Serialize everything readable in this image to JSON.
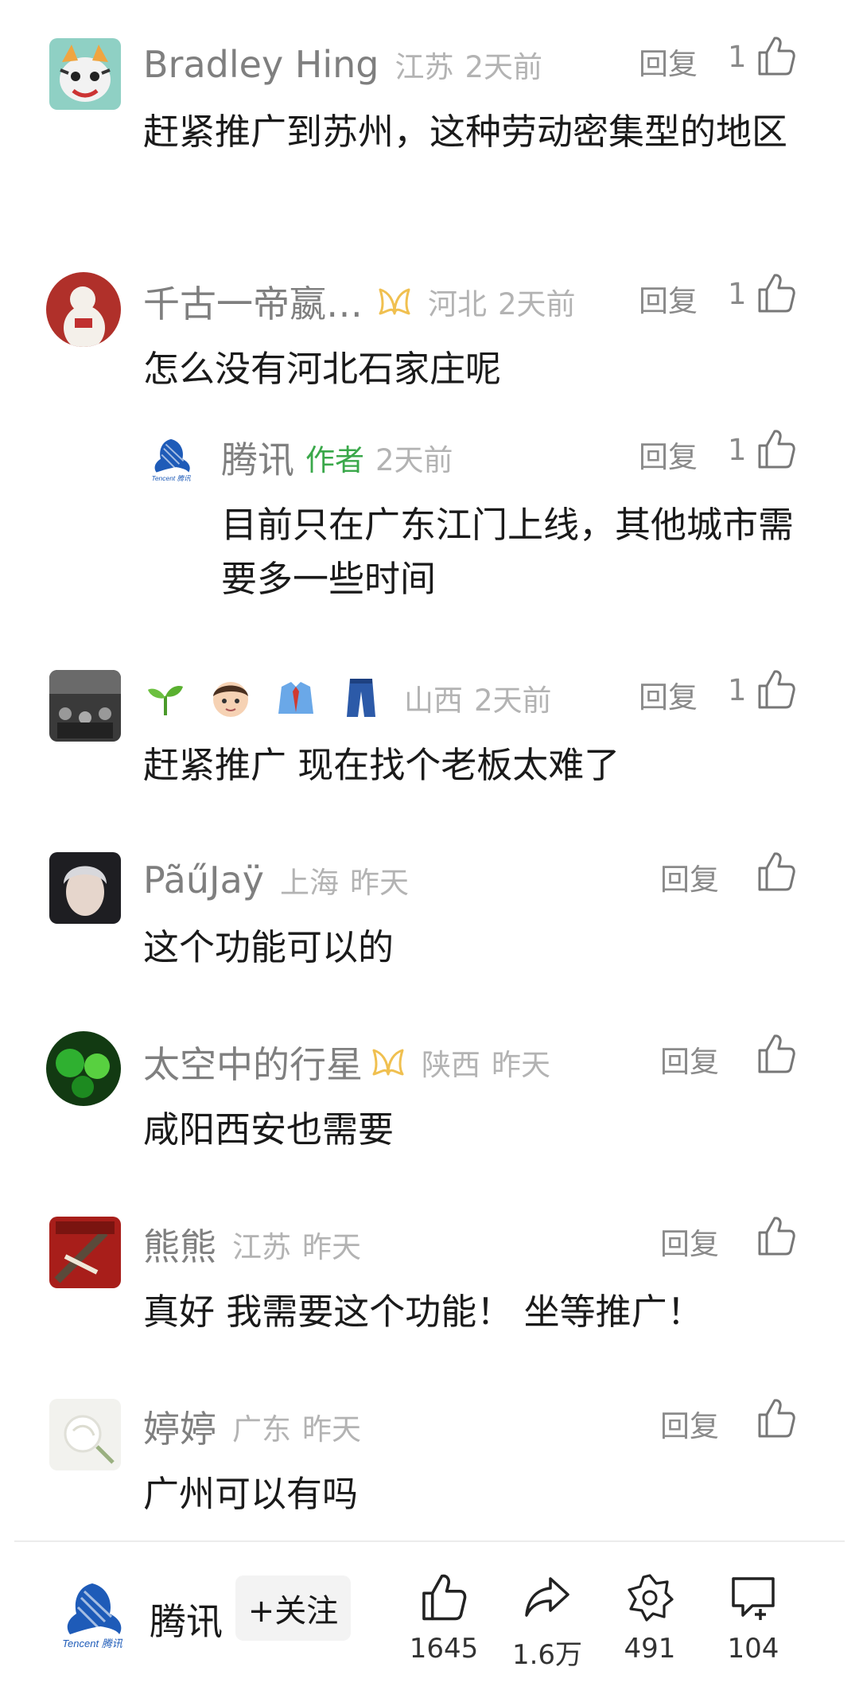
{
  "comments": [
    {
      "name": "Bradley Hing",
      "location": "江苏",
      "time": "2天前",
      "reply": "回复",
      "likes": "1",
      "content": "赶紧推广到苏州，这种劳动密集型的地区"
    },
    {
      "name": "千古一帝嬴…",
      "badge": "vip-badge-icon",
      "location": "河北",
      "time": "2天前",
      "reply": "回复",
      "likes": "1",
      "content": "怎么没有河北石家庄呢"
    },
    {
      "name": "腾讯",
      "author_tag": "作者",
      "time": "2天前",
      "reply": "回复",
      "likes": "1",
      "content": "目前只在广东江门上线，其他城市需要多一些时间"
    },
    {
      "emojis": [
        "seedling-emoji",
        "boy-emoji",
        "shirt-tie-emoji",
        "jeans-emoji"
      ],
      "location": "山西",
      "time": "2天前",
      "reply": "回复",
      "likes": "1",
      "content": "赶紧推广 现在找个老板太难了"
    },
    {
      "name": "PãűJaÿ",
      "location": "上海",
      "time": "昨天",
      "reply": "回复",
      "content": "这个功能可以的"
    },
    {
      "name": "太空中的行星",
      "badge": "vip-badge-icon",
      "location": "陕西",
      "time": "昨天",
      "reply": "回复",
      "content": "咸阳西安也需要"
    },
    {
      "name": "熊熊",
      "location": "江苏",
      "time": "昨天",
      "reply": "回复",
      "content": "真好 我需要这个功能！  坐等推广！"
    },
    {
      "name": "婷婷",
      "location": "广东",
      "time": "昨天",
      "reply": "回复",
      "content": "广州可以有吗"
    }
  ],
  "bottom_bar": {
    "account_name": "腾讯",
    "follow_label": "+关注",
    "like_count": "1645",
    "share_count": "1.6万",
    "favorite_count": "491",
    "comment_count": "104"
  },
  "colors": {
    "author_tag": "#3aa84a",
    "badge": "#f0c050",
    "meta_gray": "#b3b3b3"
  }
}
